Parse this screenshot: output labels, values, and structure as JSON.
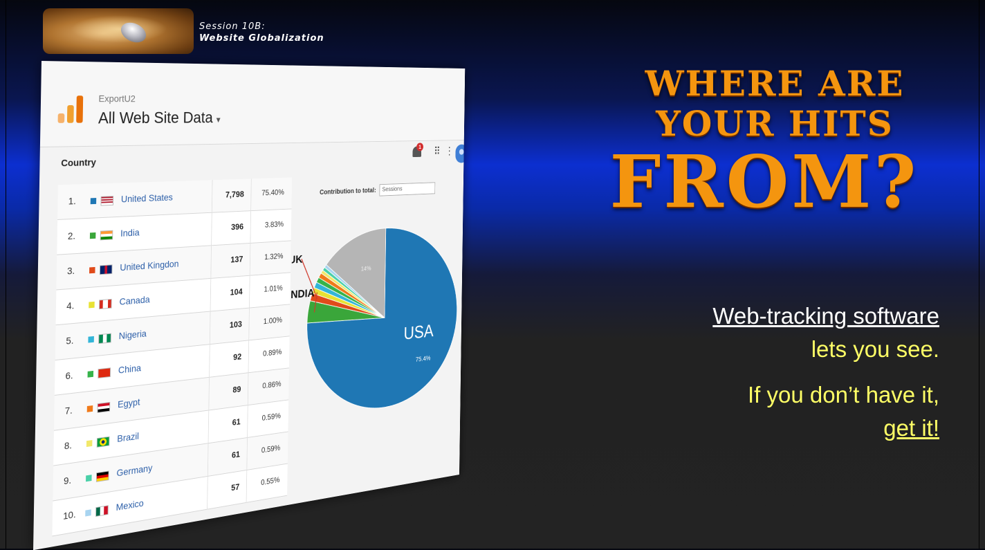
{
  "header": {
    "session_line1": "Session 10B:",
    "session_line2": "Website Globalization"
  },
  "headline": {
    "line1": "Where Are",
    "line2": "Your Hits",
    "line3": "From?"
  },
  "body_text": {
    "line1": "Web-tracking software",
    "line2": "lets you see.",
    "line3": "If you don’t have it,",
    "line4": "get it!"
  },
  "analytics": {
    "account": "ExportU2",
    "property": "All Web Site Data",
    "column_header": "Country",
    "notification_count": "1",
    "contribution_label": "Contribution to total:",
    "contribution_select": "Sessions",
    "rows": [
      {
        "rank": "1.",
        "country": "United States",
        "value": "7,798",
        "percent": "75.40%",
        "color": "#1f77b4",
        "flag": "us"
      },
      {
        "rank": "2.",
        "country": "India",
        "value": "396",
        "percent": "3.83%",
        "color": "#3aa63a",
        "flag": "in"
      },
      {
        "rank": "3.",
        "country": "United Kingdon",
        "value": "137",
        "percent": "1.32%",
        "color": "#e04b1a",
        "flag": "uk"
      },
      {
        "rank": "4.",
        "country": "Canada",
        "value": "104",
        "percent": "1.01%",
        "color": "#e8e234",
        "flag": "ca"
      },
      {
        "rank": "5.",
        "country": "Nigeria",
        "value": "103",
        "percent": "1.00%",
        "color": "#33b5d8",
        "flag": "ng"
      },
      {
        "rank": "6.",
        "country": "China",
        "value": "92",
        "percent": "0.89%",
        "color": "#36b34a",
        "flag": "cn"
      },
      {
        "rank": "7.",
        "country": "Egypt",
        "value": "89",
        "percent": "0.86%",
        "color": "#f07a1a",
        "flag": "eg"
      },
      {
        "rank": "8.",
        "country": "Brazil",
        "value": "61",
        "percent": "0.59%",
        "color": "#f2e86a",
        "flag": "br"
      },
      {
        "rank": "9.",
        "country": "Germany",
        "value": "61",
        "percent": "0.59%",
        "color": "#4ad0a8",
        "flag": "de"
      },
      {
        "rank": "10.",
        "country": "Mexico",
        "value": "57",
        "percent": "0.55%",
        "color": "#a8d4f0",
        "flag": "mx"
      }
    ],
    "pie": {
      "other_percent": 13.95,
      "other_color": "#b5b5b5",
      "other_label": "14%",
      "main_label": "75.4%",
      "callouts": {
        "usa": "USA",
        "uk": "UK",
        "india": "INDIA"
      }
    }
  }
}
